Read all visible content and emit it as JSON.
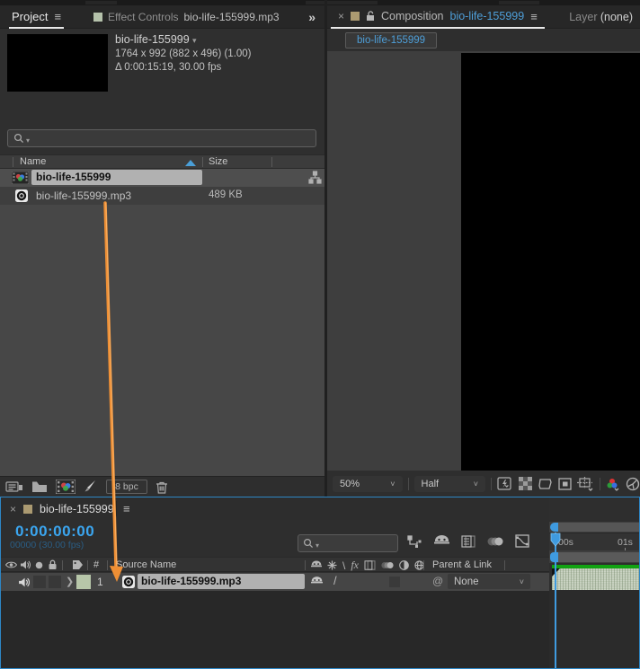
{
  "colors": {
    "accent_blue": "#4e9fd9",
    "timecode_blue": "#3ba6f0",
    "selection_gray": "#b1b1b1",
    "label_green": "#b7c6a9",
    "render_green": "#12a212",
    "arrow_orange": "#ee8f35",
    "tab_square_tan": "#ab9a71",
    "tab_square_sage": "#b5c2ab",
    "panel_focus_border": "#2d86c5"
  },
  "glyphs": {
    "menu": "≡",
    "overflow": "»",
    "close": "×",
    "caret_down": "▾",
    "chevron_down": "˅",
    "expander": "❯",
    "slash": "/",
    "pick_whip": "@",
    "fx": "fx",
    "hash": "#"
  },
  "project_panel": {
    "tabs": {
      "active": "Project",
      "inactive_label": "Effect Controls",
      "inactive_file": "bio-life-155999.mp3"
    },
    "preview": {
      "name": "bio-life-155999",
      "dimensions": "1764 x 992  (882 x 496) (1.00)",
      "duration": "Δ 0:00:15:19, 30.00 fps"
    },
    "search": {
      "placeholder": "",
      "value": ""
    },
    "columns": {
      "name": "Name",
      "size": "Size"
    },
    "rows": [
      {
        "name": "bio-life-155999",
        "size": "",
        "type": "composition",
        "selected": true
      },
      {
        "name": "bio-life-155999.mp3",
        "size": "489 KB",
        "type": "audio",
        "selected": false
      }
    ],
    "footer": {
      "bit_depth": "8 bpc"
    }
  },
  "composition_panel": {
    "tab": {
      "label": "Composition",
      "comp_name": "bio-life-155999"
    },
    "layer_tab": {
      "label": "Layer",
      "value": "(none)"
    },
    "breadcrumb": "bio-life-155999",
    "zoom_value": "50%",
    "resolution_value": "Half"
  },
  "timeline_panel": {
    "tab_name": "bio-life-155999",
    "timecode": "0:00:00:00",
    "frame_info": "00000 (30.00 fps)",
    "search": {
      "placeholder": "",
      "value": ""
    },
    "columns": {
      "number": "#",
      "source_name": "Source Name",
      "parent": "Parent & Link"
    },
    "layer": {
      "number": "1",
      "name": "bio-life-155999.mp3",
      "parent_value": "None"
    },
    "ruler": {
      "t0": "00s",
      "t1": "01s"
    }
  }
}
